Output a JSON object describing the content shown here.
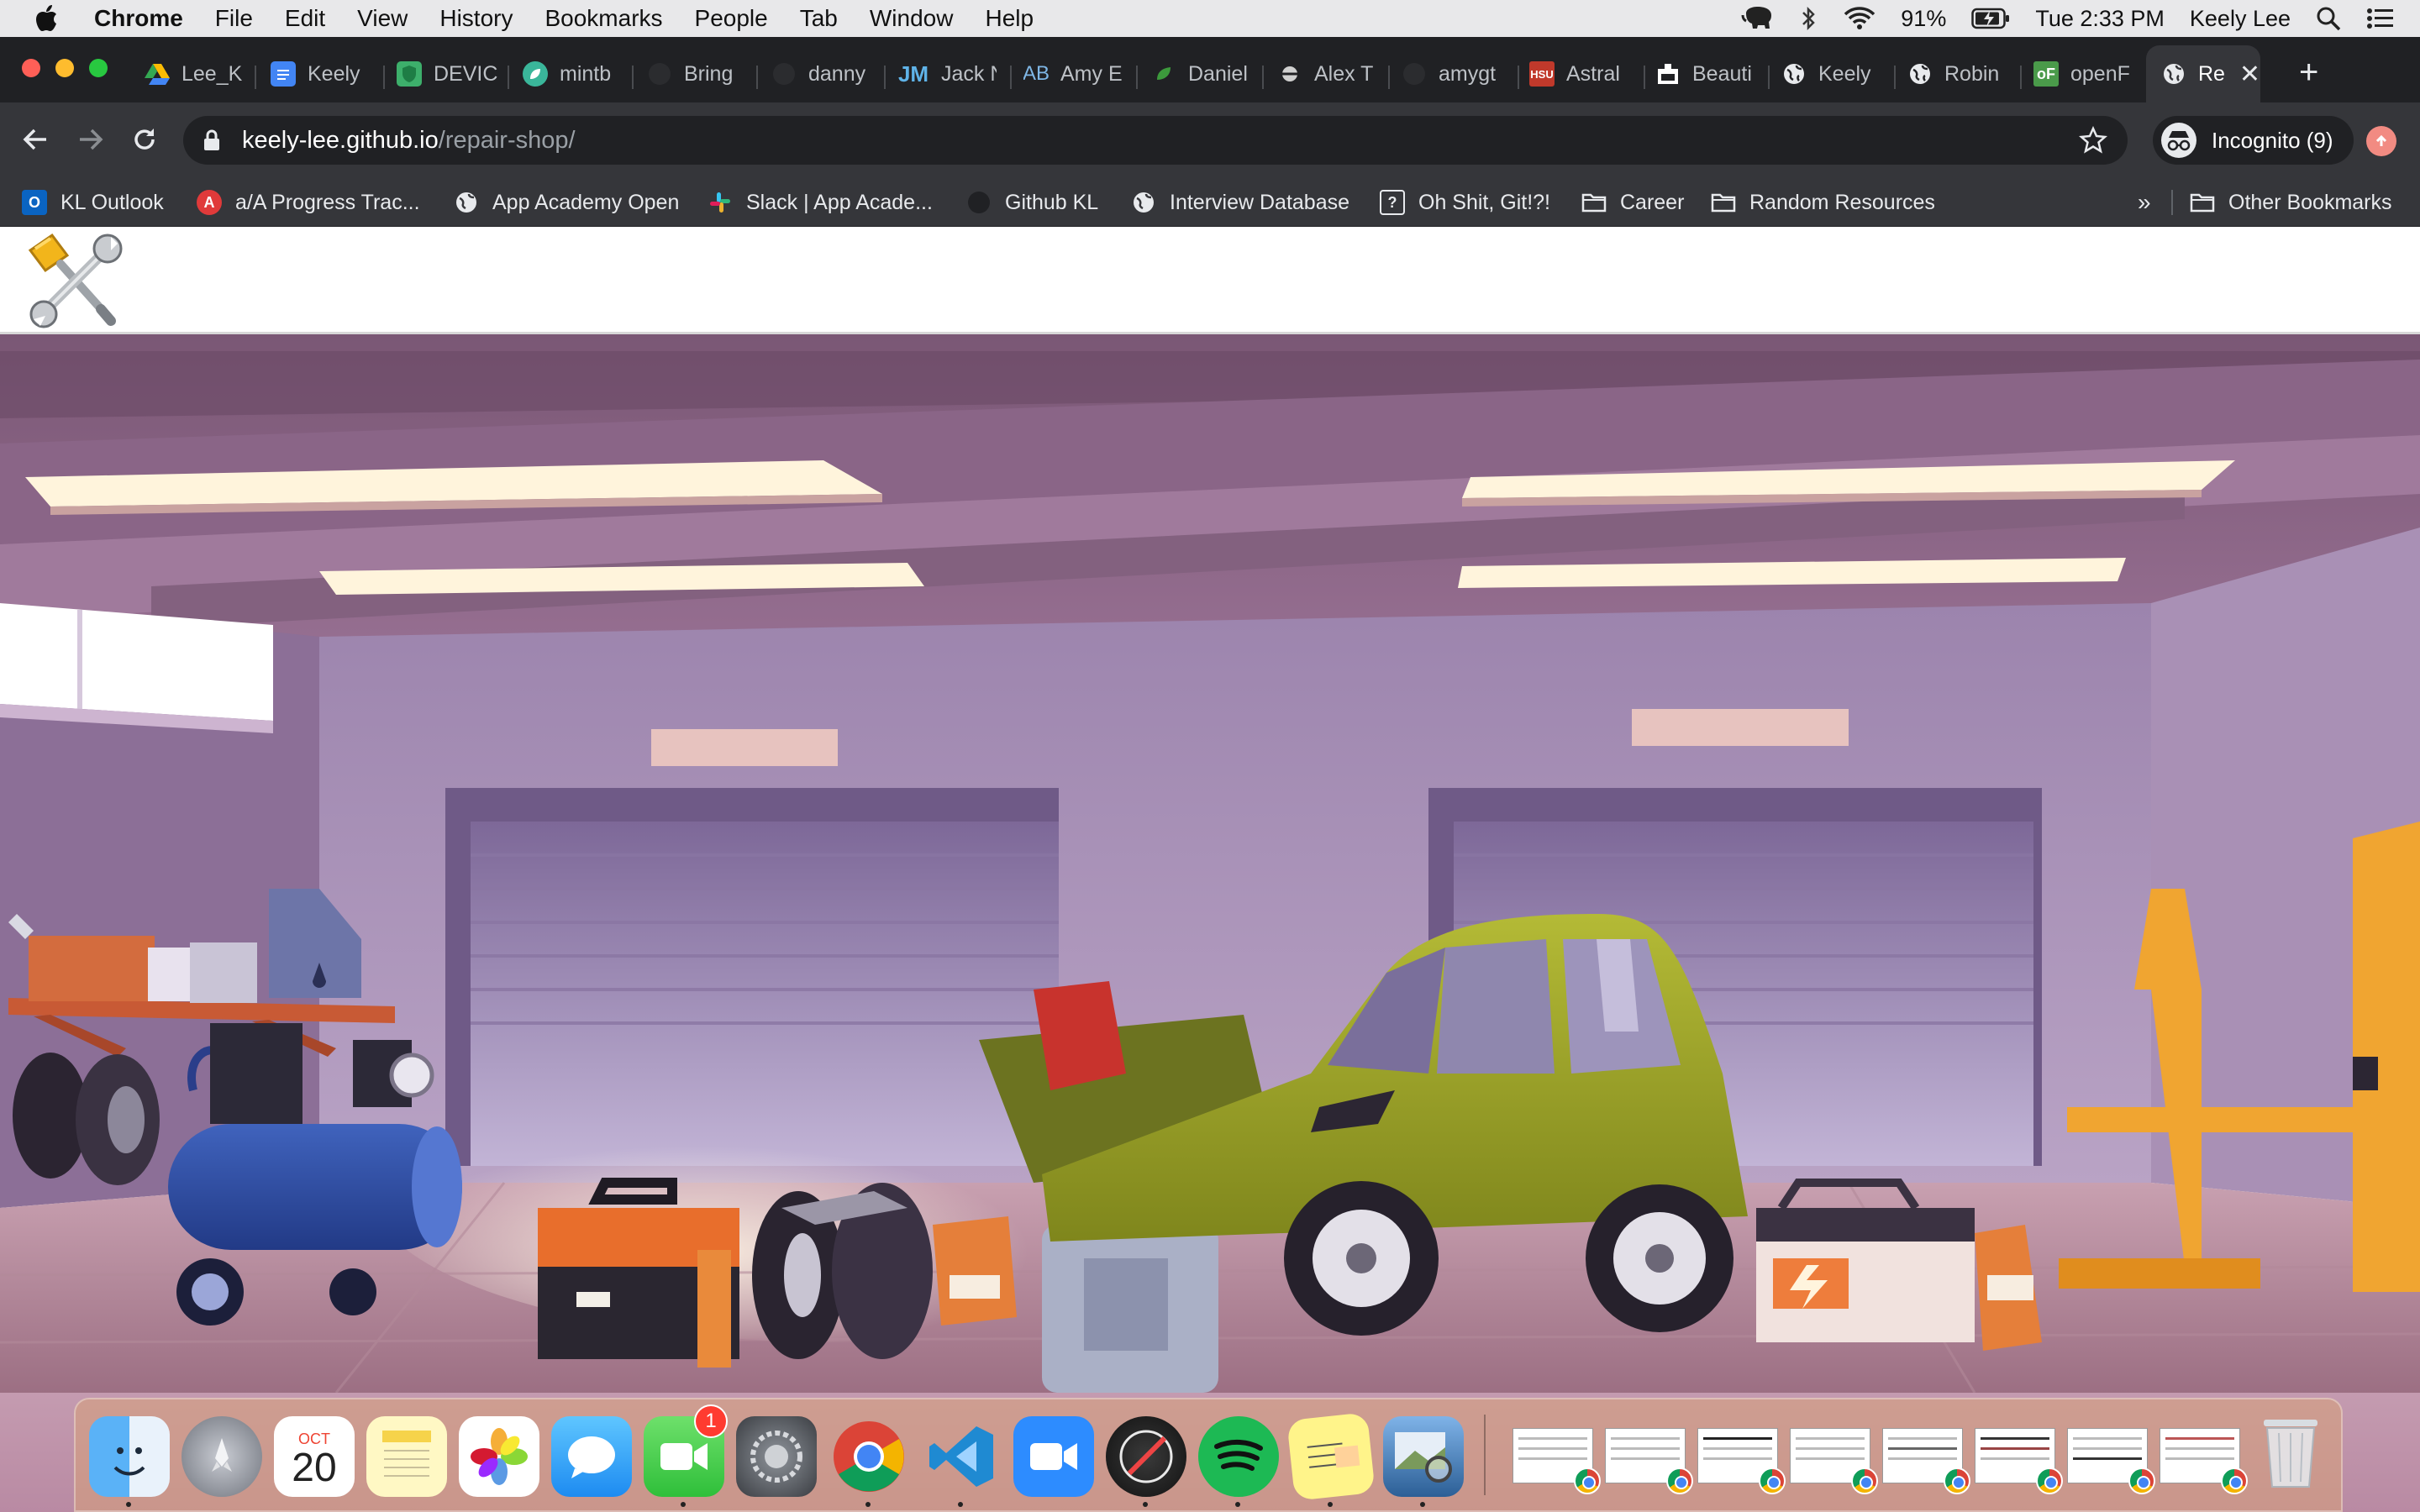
{
  "menubar": {
    "items": [
      "Chrome",
      "File",
      "Edit",
      "View",
      "History",
      "Bookmarks",
      "People",
      "Tab",
      "Window",
      "Help"
    ],
    "battery": "91%",
    "clock": "Tue 2:33 PM",
    "user": "Keely Lee"
  },
  "tabs": [
    {
      "label": "Lee_K",
      "icon": "google-drive-icon"
    },
    {
      "label": "Keely",
      "icon": "google-docs-icon"
    },
    {
      "label": "DEVIC",
      "icon": "shield-green-icon"
    },
    {
      "label": "mintb",
      "icon": "mint-leaf-icon"
    },
    {
      "label": "Bring",
      "icon": "github-icon"
    },
    {
      "label": "danny",
      "icon": "github-icon"
    },
    {
      "label": "Jack N",
      "icon": "jm-logo-icon"
    },
    {
      "label": "Amy E",
      "icon": "ab-logo-icon"
    },
    {
      "label": "Daniel",
      "icon": "leaf-icon"
    },
    {
      "label": "Alex T",
      "icon": "alex-logo-icon"
    },
    {
      "label": "amygt",
      "icon": "github-icon"
    },
    {
      "label": "Astral",
      "icon": "hsu-logo-icon"
    },
    {
      "label": "Beauti",
      "icon": "beauty-logo-icon"
    },
    {
      "label": "Keely",
      "icon": "globe-icon"
    },
    {
      "label": "Robin",
      "icon": "globe-icon"
    },
    {
      "label": "openF",
      "icon": "openf-logo-icon"
    }
  ],
  "active_tab": {
    "label": "Re",
    "icon": "globe-icon"
  },
  "omnibox": {
    "host": "keely-lee.github.io",
    "path": "/repair-shop/"
  },
  "incognito": {
    "label": "Incognito (9)"
  },
  "bookmarks": [
    {
      "label": "KL Outlook",
      "icon": "outlook-icon"
    },
    {
      "label": "a/A Progress Trac...",
      "icon": "app-academy-icon"
    },
    {
      "label": "App Academy Open",
      "icon": "globe-icon"
    },
    {
      "label": "Slack | App Acade...",
      "icon": "slack-icon"
    },
    {
      "label": "Github KL",
      "icon": "github-icon"
    },
    {
      "label": "Interview Database",
      "icon": "globe-icon"
    },
    {
      "label": "Oh Shit, Git!?!",
      "icon": "ohshitgit-icon"
    },
    {
      "label": "Career",
      "icon": "folder-icon"
    },
    {
      "label": "Random Resources",
      "icon": "folder-icon"
    }
  ],
  "bookmarks_overflow": "»",
  "other_bookmarks": "Other Bookmarks",
  "dock": {
    "calendar_month": "OCT",
    "calendar_day": "20",
    "facetime_badge": "1",
    "apps": [
      "finder-icon",
      "launchpad-icon",
      "calendar-icon",
      "notes-icon",
      "photos-icon",
      "messages-icon",
      "facetime-icon",
      "system-preferences-icon",
      "chrome-icon",
      "vscode-icon",
      "zoom-icon",
      "instruments-icon",
      "spotify-icon",
      "stickies-icon",
      "preview-icon"
    ],
    "minimized_windows": 8,
    "trash": "trash-icon"
  },
  "colors": {
    "chrome_dark": "#202124",
    "toolbar": "#35363a",
    "garage_wall": "#a48bb4",
    "car": "#9aa22c",
    "compressor": "#2d4a9c"
  }
}
